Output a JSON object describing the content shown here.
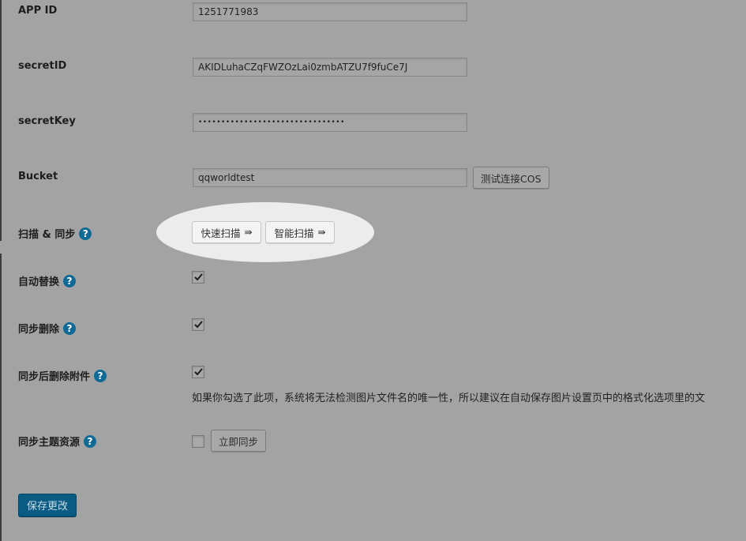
{
  "fields": {
    "app_id": {
      "label": "APP ID",
      "value": "1251771983"
    },
    "secret_id": {
      "label": "secretID",
      "value": "AKIDLuhaCZqFWZOzLai0zmbATZU7f9fuCe7J"
    },
    "secret_key": {
      "label": "secretKey",
      "value": "••••••••••••••••••••••••••••••••"
    },
    "bucket": {
      "label": "Bucket",
      "value": "qqworldtest",
      "test_button": "测试连接COS"
    }
  },
  "scan_sync": {
    "label": "扫描 & 同步",
    "quick_scan": "快速扫描",
    "smart_scan": "智能扫描",
    "arrow": "⇛"
  },
  "auto_replace": {
    "label": "自动替换",
    "checked": true
  },
  "sync_delete": {
    "label": "同步删除",
    "checked": true
  },
  "sync_delete_attachments": {
    "label": "同步后删除附件",
    "checked": true,
    "description": "如果你勾选了此项，系统将无法检测图片文件名的唯一性，所以建议在自动保存图片设置页中的格式化选项里的文"
  },
  "sync_theme": {
    "label": "同步主题资源",
    "checked": false,
    "button": "立即同步"
  },
  "help": "?",
  "save_button": "保存更改"
}
